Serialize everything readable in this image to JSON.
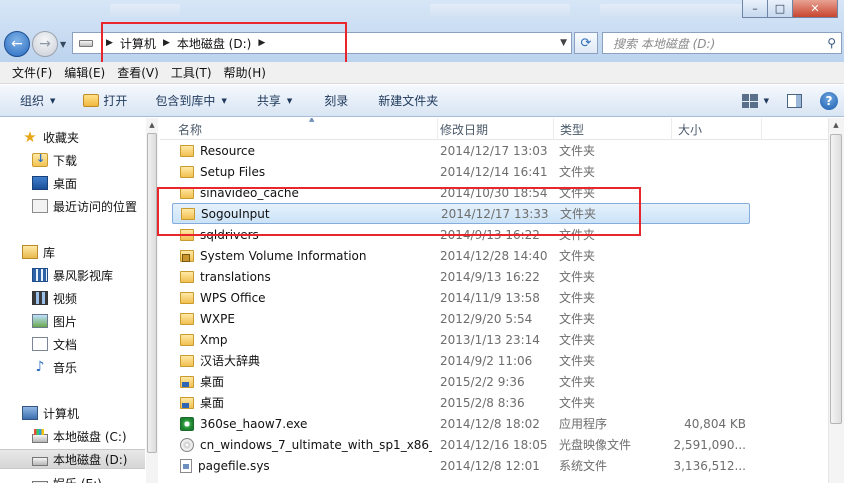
{
  "address": {
    "crumbs": [
      "计算机",
      "本地磁盘 (D:)"
    ]
  },
  "search": {
    "placeholder": "搜索 本地磁盘 (D:)"
  },
  "menu": [
    "文件(F)",
    "编辑(E)",
    "查看(V)",
    "工具(T)",
    "帮助(H)"
  ],
  "toolbar": {
    "organize": "组织",
    "open": "打开",
    "include_library": "包含到库中",
    "share": "共享",
    "burn": "刻录",
    "new_folder": "新建文件夹"
  },
  "nav": {
    "favorites": "收藏夹",
    "downloads": "下载",
    "desktop": "桌面",
    "recent": "最近访问的位置",
    "libraries": "库",
    "baofeng": "暴风影视库",
    "videos": "视频",
    "pictures": "图片",
    "documents": "文档",
    "music": "音乐",
    "computer": "计算机",
    "drive_c": "本地磁盘 (C:)",
    "drive_d": "本地磁盘 (D:)",
    "drive_e": "娱乐 (E:)"
  },
  "columns": {
    "name": "名称",
    "modified": "修改日期",
    "type": "类型",
    "size": "大小"
  },
  "files": [
    {
      "name": "Resource",
      "date": "2014/12/17 13:03",
      "type": "文件夹",
      "size": "",
      "icon": "folder-icon"
    },
    {
      "name": "Setup Files",
      "date": "2014/12/14 16:41",
      "type": "文件夹",
      "size": "",
      "icon": "folder-icon"
    },
    {
      "name": "sinavideo_cache",
      "date": "2014/10/30 18:54",
      "type": "文件夹",
      "size": "",
      "icon": "folder-icon"
    },
    {
      "name": "SogouInput",
      "date": "2014/12/17 13:33",
      "type": "文件夹",
      "size": "",
      "icon": "folder-icon",
      "selected": true
    },
    {
      "name": "sqldrivers",
      "date": "2014/9/13 16:22",
      "type": "文件夹",
      "size": "",
      "icon": "folder-icon"
    },
    {
      "name": "System Volume Information",
      "date": "2014/12/28 14:40",
      "type": "文件夹",
      "size": "",
      "icon": "locked-folder-icon"
    },
    {
      "name": "translations",
      "date": "2014/9/13 16:22",
      "type": "文件夹",
      "size": "",
      "icon": "folder-icon"
    },
    {
      "name": "WPS Office",
      "date": "2014/11/9 13:58",
      "type": "文件夹",
      "size": "",
      "icon": "folder-icon"
    },
    {
      "name": "WXPE",
      "date": "2012/9/20 5:54",
      "type": "文件夹",
      "size": "",
      "icon": "folder-icon"
    },
    {
      "name": "Xmp",
      "date": "2013/1/13 23:14",
      "type": "文件夹",
      "size": "",
      "icon": "folder-icon"
    },
    {
      "name": "汉语大辞典",
      "date": "2014/9/2 11:06",
      "type": "文件夹",
      "size": "",
      "icon": "folder-icon"
    },
    {
      "name": "桌面",
      "date": "2015/2/2 9:36",
      "type": "文件夹",
      "size": "",
      "icon": "desktop-folder-icon"
    },
    {
      "name": "桌面",
      "date": "2015/2/8 8:36",
      "type": "文件夹",
      "size": "",
      "icon": "desktop-folder-icon"
    },
    {
      "name": "360se_haow7.exe",
      "date": "2014/12/8 18:02",
      "type": "应用程序",
      "size": "40,804 KB",
      "icon": "exe-icon"
    },
    {
      "name": "cn_windows_7_ultimate_with_sp1_x86_...",
      "date": "2014/12/16 18:05",
      "type": "光盘映像文件",
      "size": "2,591,090...",
      "icon": "disc-image-icon"
    },
    {
      "name": "pagefile.sys",
      "date": "2014/12/8 12:01",
      "type": "系统文件",
      "size": "3,136,512...",
      "icon": "system-file-icon"
    }
  ]
}
